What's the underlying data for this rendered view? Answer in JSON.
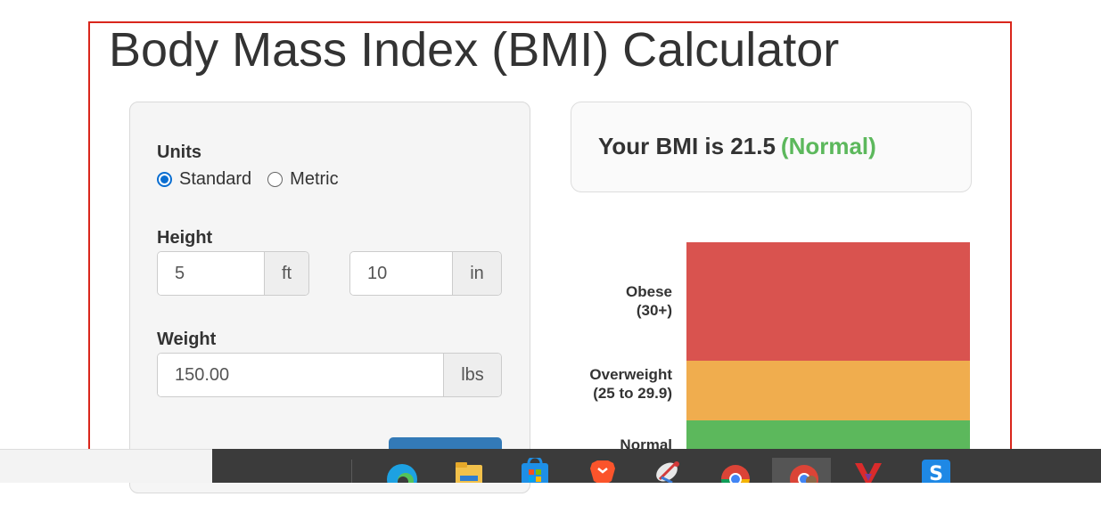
{
  "page": {
    "title": "Body Mass Index (BMI) Calculator"
  },
  "form": {
    "units_label": "Units",
    "units_options": [
      "Standard",
      "Metric"
    ],
    "units_selected": "Standard",
    "height_label": "Height",
    "height_ft_value": "5",
    "height_ft_unit": "ft",
    "height_in_value": "10",
    "height_in_unit": "in",
    "weight_label": "Weight",
    "weight_value": "150.00",
    "weight_unit": "lbs"
  },
  "result": {
    "prefix": "Your BMI is 21.5",
    "category": "(Normal)",
    "category_color": "#5cb85c"
  },
  "bmi_scale": {
    "bands": [
      {
        "name": "Obese",
        "range": "(30+)",
        "color": "#d9534f"
      },
      {
        "name": "Overweight",
        "range": "(25 to 29.9)",
        "color": "#f0ad4e"
      },
      {
        "name": "Normal",
        "range": "",
        "color": "#5cb85c"
      }
    ]
  },
  "taskbar": {
    "icons": [
      "edge-icon",
      "file-explorer-icon",
      "microsoft-store-icon",
      "brave-icon",
      "satellite-app-icon",
      "chrome-icon",
      "chrome-profile-icon",
      "vivaldi-icon",
      "s-app-icon"
    ]
  }
}
